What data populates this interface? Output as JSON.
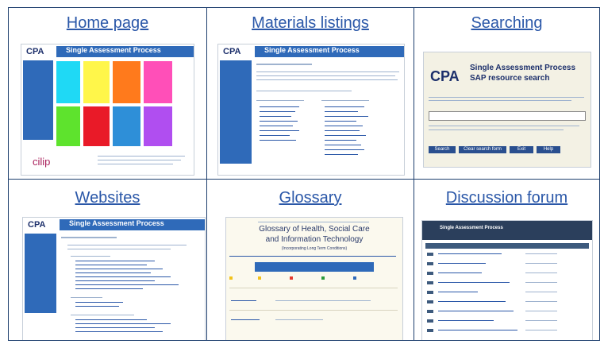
{
  "thumbnails": [
    {
      "caption": "Home page",
      "banner": "Single Assessment Process",
      "logo": "CPA",
      "footer_logo": "cilip"
    },
    {
      "caption": "Materials listings",
      "banner": "Single Assessment Process",
      "logo": "CPA"
    },
    {
      "caption": "Searching",
      "banner": "Single Assessment Process",
      "sub": "SAP resource search",
      "logo": "CPA",
      "buttons": [
        "Search",
        "Clear search form",
        "Exit",
        "Help"
      ]
    },
    {
      "caption": "Websites",
      "banner": "Single Assessment Process",
      "logo": "CPA"
    },
    {
      "caption": "Glossary",
      "title_line1": "Glossary of Health, Social Care",
      "title_line2": "and Information Technology",
      "note": "(Incorporating Long Term Conditions)"
    },
    {
      "caption": "Discussion forum",
      "banner": "Single Assessment Process"
    }
  ],
  "colors": {
    "border": "#1e3f6e",
    "link": "#2a57a8",
    "sap_blue": "#2f6ab9",
    "tile_colors": [
      "#1fd9f5",
      "#fff64a",
      "#ff7a1c",
      "#ff4fb8",
      "#5ee32d",
      "#e91a28",
      "#2e8fd8",
      "#b04ef0"
    ]
  }
}
